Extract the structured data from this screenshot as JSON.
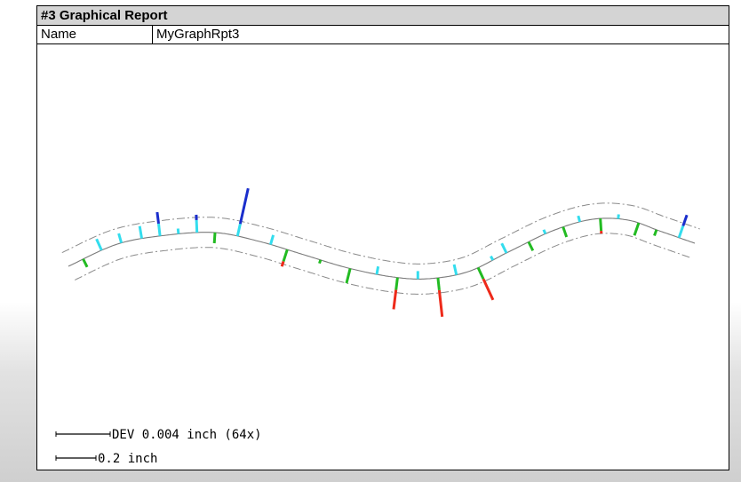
{
  "report": {
    "title": "#3  Graphical Report",
    "name_label": "Name",
    "name_value": "MyGraphRpt3"
  },
  "legend": {
    "deviation_label": "DEV 0.004 inch (64x)",
    "scale_label": "0.2 inch"
  },
  "colors": {
    "nominal_curve": "#7a7a7a",
    "tolerance_band": "#8a8a8a",
    "in_tol_positive": "#33ddee",
    "in_tol_negative": "#22bb22",
    "out_tol_positive": "#1a2ecc",
    "out_tol_negative": "#ee2a1a"
  }
}
